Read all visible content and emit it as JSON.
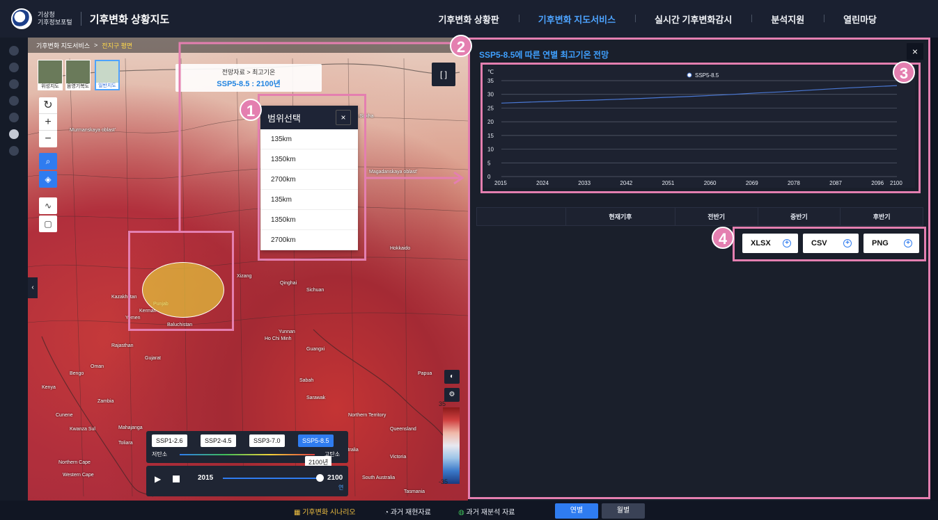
{
  "header": {
    "org_line1": "기상청",
    "org_line2": "기후정보포털",
    "title": "기후변화 상황지도",
    "nav": [
      {
        "label": "기후변화 상황판"
      },
      {
        "label": "기후변화 지도서비스"
      },
      {
        "label": "실시간 기후변화감시"
      },
      {
        "label": "분석지원"
      },
      {
        "label": "열린마당"
      }
    ],
    "active_nav": "기후변화 지도서비스"
  },
  "map": {
    "breadcrumb": {
      "parent": "기후변화 지도서비스",
      "separator": ">",
      "current": "전지구 평면"
    },
    "map_types": [
      {
        "label": "위성지도"
      },
      {
        "label": "음영기복도"
      },
      {
        "label": "일반지도"
      }
    ],
    "active_map_type": "일반지도",
    "zoom_reset": "↻",
    "zoom_in": "+",
    "zoom_out": "−",
    "info": {
      "path": "전망자료 > 최고기온",
      "scenario": "SSP5-8.5 : 2100년"
    },
    "expand_label": "[ ]",
    "collapse_arrow": "‹",
    "legend": {
      "max": "35",
      "min": "-35"
    },
    "scenarios": [
      {
        "label": "SSP1-2.6"
      },
      {
        "label": "SSP2-4.5"
      },
      {
        "label": "SSP3-7.0"
      },
      {
        "label": "SSP5-8.5"
      }
    ],
    "active_scenario": "SSP5-8.5",
    "carbon_low": "저탄소",
    "carbon_high": "고탄소",
    "year_tag": "2100년",
    "player": {
      "start": "2015",
      "end": "2100",
      "unit": "연"
    },
    "place_labels": [
      "Murmanskaya oblast'",
      "Respublika Sakha",
      "Magadanskaya oblast'",
      "Kazakhstan",
      "Hokkaido",
      "Sichuan",
      "Yunnan",
      "Guangxi",
      "Western Australia",
      "Queensland",
      "Northern Territory",
      "South Australia",
      "Victoria",
      "Tasmania",
      "Northern Cape",
      "Western Cape",
      "Bengo",
      "Cunene",
      "Kwanza Sul",
      "Mahajanga",
      "Toliara",
      "Sabah",
      "Sarawak",
      "Papua",
      "Ho Chi Minh",
      "Qinghai",
      "Xizang",
      "Gujarat",
      "Rajasthan",
      "Punjab",
      "Baluchistan",
      "Kerman",
      "Yemen",
      "Oman",
      "Kenya",
      "Zambia"
    ]
  },
  "range_select": {
    "title": "범위선택",
    "close": "×",
    "items": [
      "135km",
      "1350km",
      "2700km",
      "135km",
      "1350km",
      "2700km"
    ]
  },
  "panel": {
    "title": "SSP5-8.5에 따른 연별 최고기온 전망",
    "close": "×",
    "table_headers": [
      "",
      "현재기후",
      "전반기",
      "중반기",
      "후반기"
    ],
    "downloads": [
      {
        "label": "XLSX"
      },
      {
        "label": "CSV"
      },
      {
        "label": "PNG"
      }
    ]
  },
  "annotations": [
    "1",
    "2",
    "3",
    "4"
  ],
  "bottom": {
    "items": [
      {
        "label": "기후변화 시나리오"
      },
      {
        "label": "과거 재현자료"
      },
      {
        "label": "과거 재분석 자료"
      }
    ],
    "period_buttons": [
      {
        "label": "연별"
      },
      {
        "label": "월별"
      }
    ],
    "active_period": "연별"
  },
  "chart_data": {
    "type": "line",
    "title": "",
    "ylabel": "℃",
    "xlabel": "",
    "xlim": [
      2015,
      2100
    ],
    "ylim": [
      0,
      35
    ],
    "yticks": [
      0,
      5,
      10,
      15,
      20,
      25,
      30,
      35
    ],
    "xticks": [
      2015,
      2024,
      2033,
      2042,
      2051,
      2060,
      2069,
      2078,
      2087,
      2096,
      2100
    ],
    "legend": "top-center",
    "grid": true,
    "series": [
      {
        "name": "SSP5-8.5",
        "color": "#4a78d4",
        "x": [
          2015,
          2020,
          2025,
          2030,
          2035,
          2040,
          2045,
          2050,
          2055,
          2060,
          2065,
          2070,
          2075,
          2080,
          2085,
          2090,
          2095,
          2100
        ],
        "values": [
          26.8,
          27.1,
          27.4,
          27.7,
          27.9,
          28.2,
          28.5,
          28.9,
          29.2,
          29.6,
          30.0,
          30.5,
          30.9,
          31.4,
          31.9,
          32.4,
          32.8,
          33.2
        ]
      }
    ]
  }
}
